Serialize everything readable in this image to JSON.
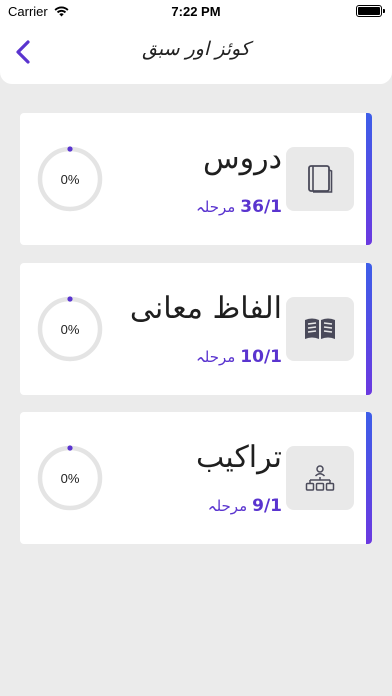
{
  "status": {
    "carrier": "Carrier",
    "time": "7:22 PM"
  },
  "header": {
    "title": "کوئز اور سبق"
  },
  "accent": "#5a34cf",
  "cards": [
    {
      "title": "دروس",
      "stage_prefix": "مرحلہ",
      "stage": "36/1",
      "progress": "0%",
      "icon": "book-icon"
    },
    {
      "title": "الفاظ معانی",
      "stage_prefix": "مرحلہ",
      "stage": "10/1",
      "progress": "0%",
      "icon": "open-book-icon"
    },
    {
      "title": "تراکیب",
      "stage_prefix": "مرحلہ",
      "stage": "9/1",
      "progress": "0%",
      "icon": "hierarchy-icon"
    }
  ]
}
